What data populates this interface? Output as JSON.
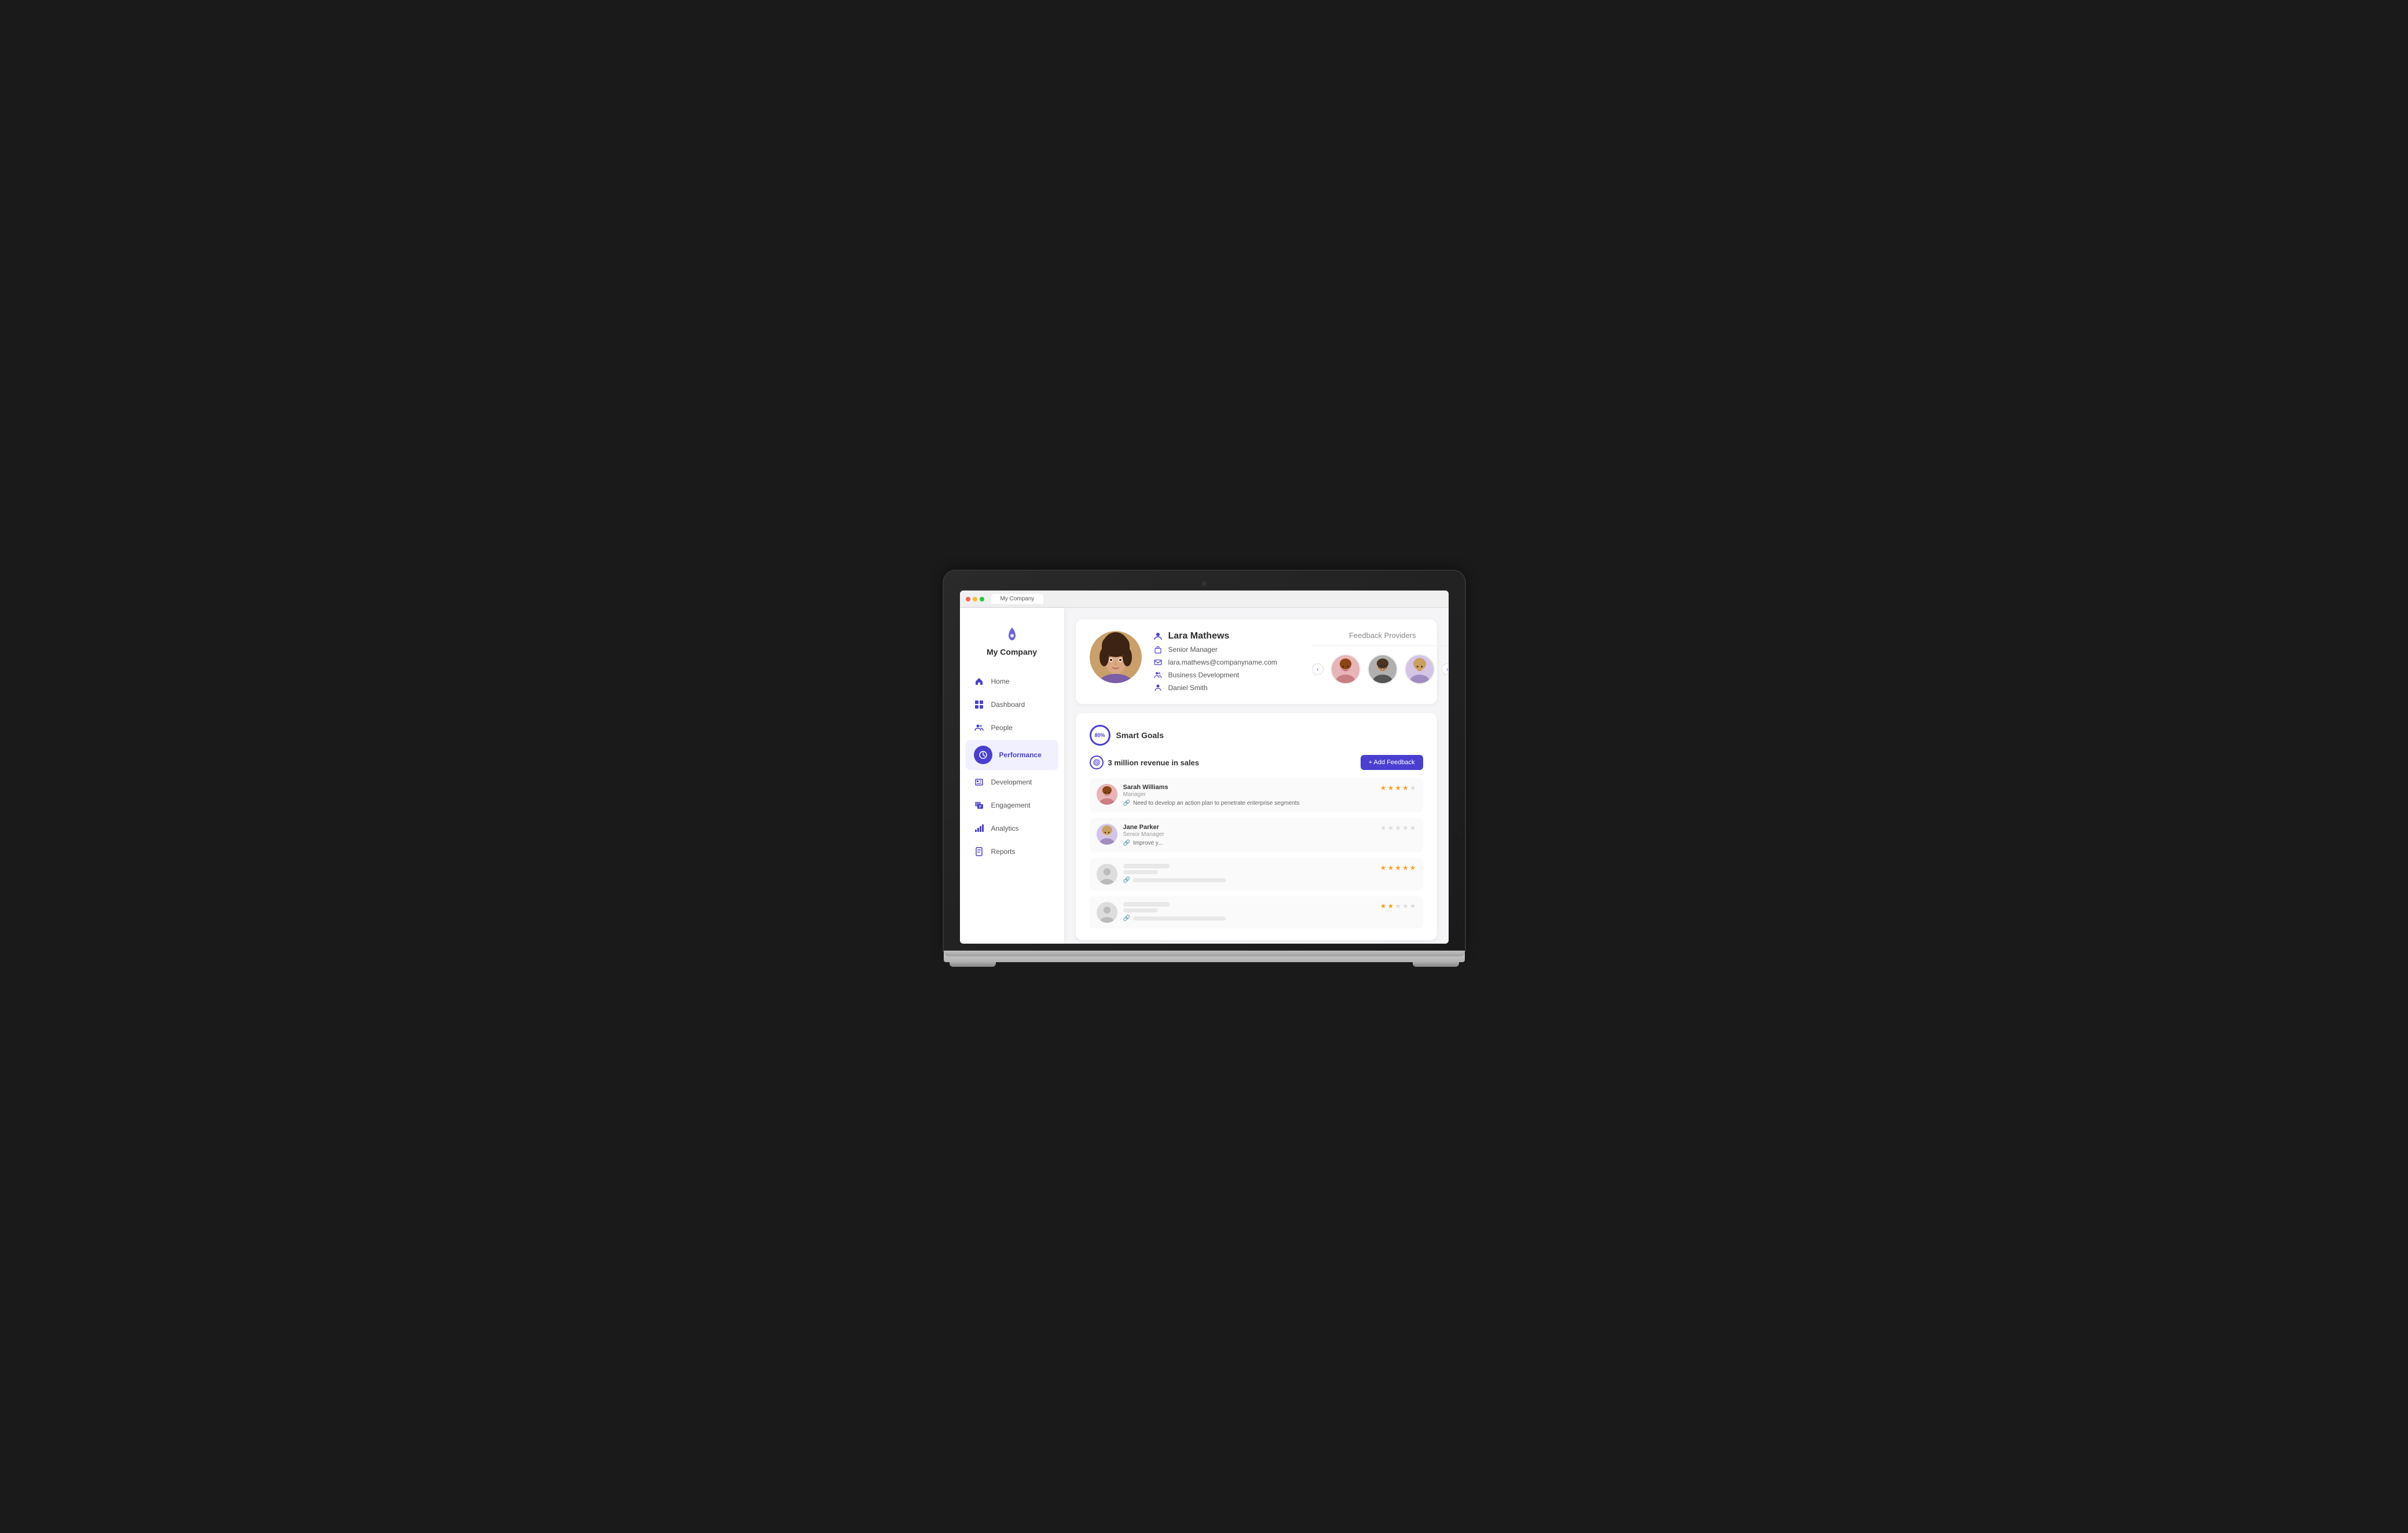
{
  "browser": {
    "dots": [
      "red",
      "yellow",
      "green"
    ],
    "tab_label": "My Company"
  },
  "sidebar": {
    "company_name": "My Company",
    "nav_items": [
      {
        "id": "home",
        "label": "Home",
        "icon": "🏠",
        "active": false
      },
      {
        "id": "dashboard",
        "label": "Dashboard",
        "icon": "🖥",
        "active": false
      },
      {
        "id": "people",
        "label": "People",
        "icon": "👥",
        "active": false
      },
      {
        "id": "performance",
        "label": "Performance",
        "icon": "⏱",
        "active": true
      },
      {
        "id": "development",
        "label": "Development",
        "icon": "📦",
        "active": false
      },
      {
        "id": "engagement",
        "label": "Engagement",
        "icon": "💬",
        "active": false
      },
      {
        "id": "analytics",
        "label": "Analytics",
        "icon": "📊",
        "active": false
      },
      {
        "id": "reports",
        "label": "Reports",
        "icon": "📋",
        "active": false
      }
    ]
  },
  "profile": {
    "name": "Lara Mathews",
    "title": "Senior Manager",
    "email": "lara.mathews@companyname.com",
    "department": "Business Development",
    "manager": "Daniel Smith"
  },
  "feedback_providers": {
    "title": "Feedback Providers",
    "prev_btn": "‹",
    "next_btn": "›"
  },
  "goals": {
    "circle_label": "80%",
    "section_title": "Smart Goals",
    "goal_name": "3 million revenue in sales",
    "add_feedback_btn": "+ Add Feedback",
    "feedback_rows": [
      {
        "name": "Sarah Williams",
        "role": "Manager",
        "comment": "Need to develop an action plan to penetrate enterprise segments",
        "stars_filled": 4,
        "stars_empty": 1
      },
      {
        "name": "Jane Parker",
        "role": "Senior Manager",
        "comment": "Improve y...",
        "stars_filled": 0,
        "stars_empty": 5
      },
      {
        "name": "",
        "role": "",
        "comment": "",
        "stars_filled": 5,
        "stars_empty": 0,
        "placeholder": true
      },
      {
        "name": "",
        "role": "",
        "comment": "",
        "stars_filled": 2,
        "stars_empty": 3,
        "placeholder": true
      }
    ]
  }
}
